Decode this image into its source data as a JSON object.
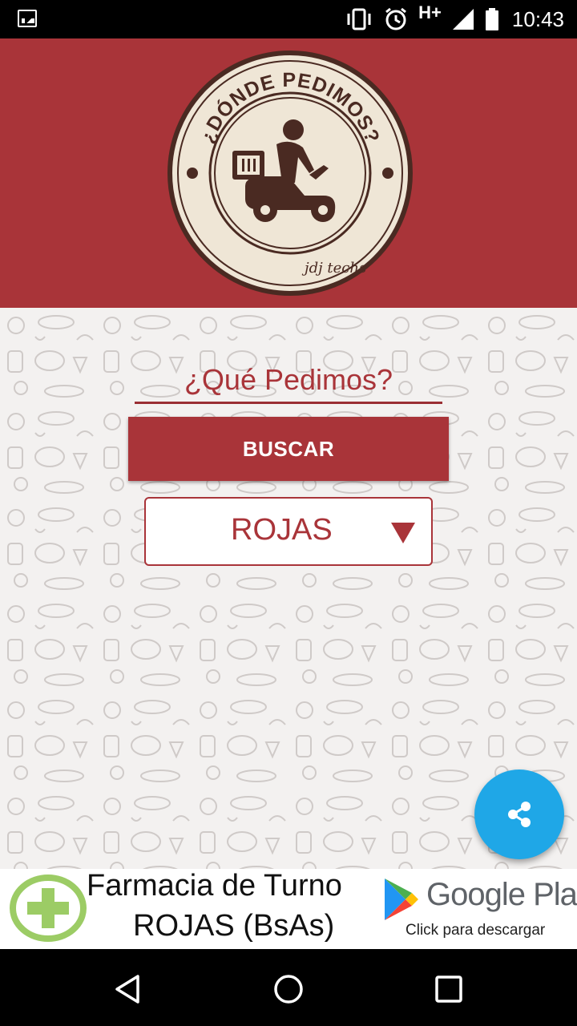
{
  "status_bar": {
    "time": "10:43",
    "network": "H+",
    "icons": [
      "image-icon",
      "vibrate-icon",
      "alarm-icon",
      "signal-icon",
      "battery-icon"
    ]
  },
  "header": {
    "logo_text": "¿DÓNDE PEDIMOS?",
    "logo_signature": "jdj techs"
  },
  "search": {
    "placeholder": "¿Qué Pedimos?"
  },
  "buscar_button": "BUSCAR",
  "city_select": {
    "selected": "ROJAS"
  },
  "fab": {
    "icon": "share-icon",
    "color": "#1fa7e7"
  },
  "ad": {
    "line1": "Farmacia de Turno",
    "line2": "ROJAS (BsAs)",
    "store": "Google Play",
    "cta": "Click para descargar"
  },
  "colors": {
    "brand": "#a93439",
    "logo_bg": "#efe6d6",
    "logo_dark": "#4a2a22"
  },
  "nav_bar": {
    "buttons": [
      "back-icon",
      "home-icon",
      "recents-icon"
    ]
  }
}
